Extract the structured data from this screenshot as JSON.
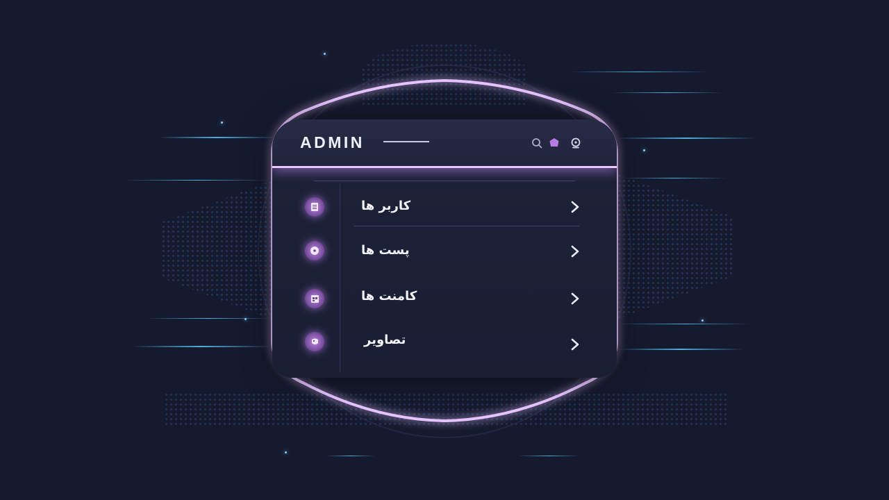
{
  "header": {
    "title": "ADMIN",
    "icons": [
      "search-icon",
      "notification-icon",
      "user-icon"
    ]
  },
  "menu": {
    "items": [
      {
        "label": "کاربر ها",
        "icon": "document-icon"
      },
      {
        "label": "پست ها",
        "icon": "disc-icon"
      },
      {
        "label": "کامنت ها",
        "icon": "calendar-icon"
      },
      {
        "label": "تصاویر",
        "icon": "image-icon"
      }
    ]
  },
  "colors": {
    "background": "#161a2e",
    "panel": "#1e2238",
    "glow": "#e8c6ff",
    "accent": "#a86ad6",
    "streak": "#5ac8ff"
  }
}
